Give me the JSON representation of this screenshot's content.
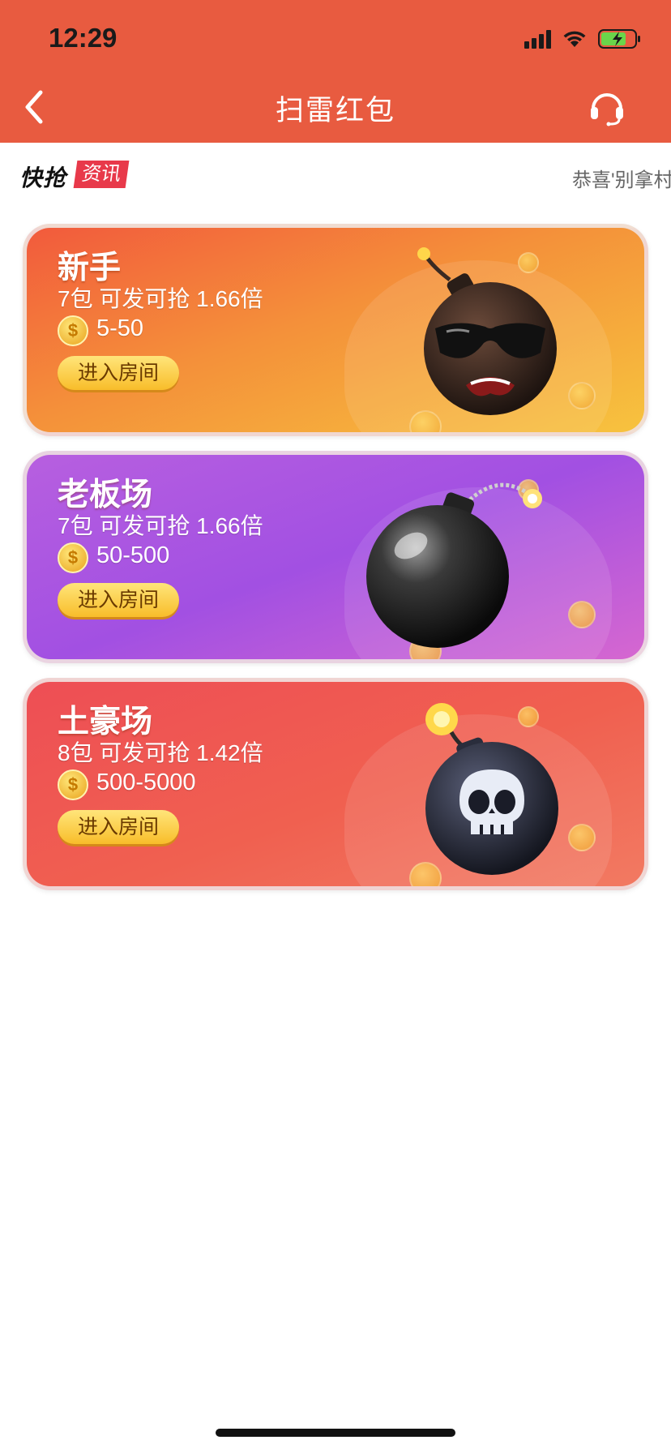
{
  "status_bar": {
    "time": "12:29"
  },
  "nav": {
    "title": "扫雷红包",
    "back_icon": "chevron-left-icon",
    "support_icon": "headset-icon"
  },
  "ticker": {
    "brand": "快抢",
    "badge": "资讯",
    "message": "恭喜'别拿村"
  },
  "rooms": [
    {
      "title": "新手",
      "desc": "7包 可发可抢 1.66倍",
      "range": "5-50",
      "button": "进入房间",
      "art": "sunglasses-bomb"
    },
    {
      "title": "老板场",
      "desc": "7包 可发可抢 1.66倍",
      "range": "50-500",
      "button": "进入房间",
      "art": "black-bomb"
    },
    {
      "title": "土豪场",
      "desc": "8包 可发可抢 1.42倍",
      "range": "500-5000",
      "button": "进入房间",
      "art": "skull-bomb"
    }
  ],
  "colors": {
    "header": "#e85b40",
    "card_1": "#f4903a",
    "card_2": "#a250e2",
    "card_3": "#f06050",
    "button": "#f8bd2a"
  }
}
